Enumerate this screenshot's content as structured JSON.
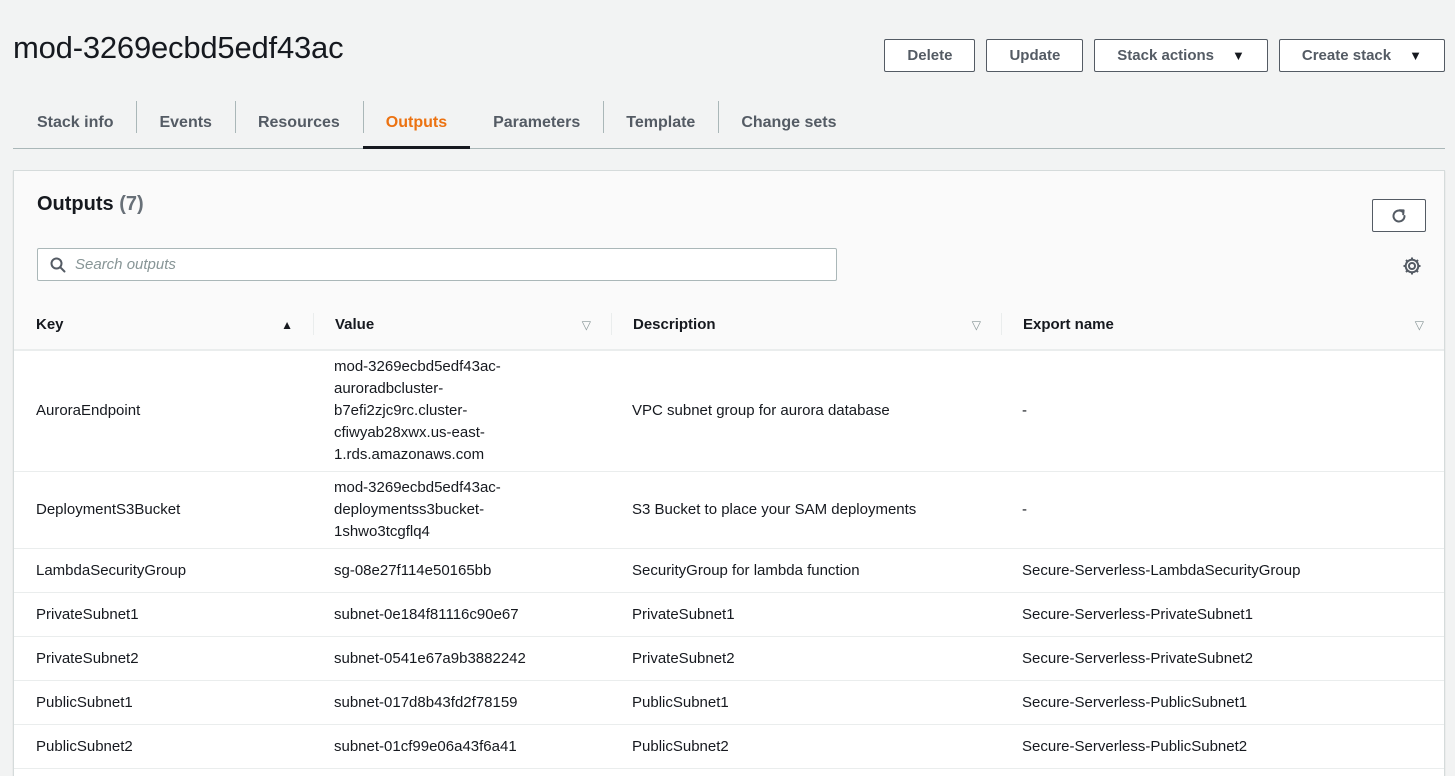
{
  "stack": {
    "name": "mod-3269ecbd5edf43ac"
  },
  "actions": {
    "delete": "Delete",
    "update": "Update",
    "stack_actions": "Stack actions",
    "create_stack": "Create stack"
  },
  "tabs": [
    {
      "label": "Stack info"
    },
    {
      "label": "Events"
    },
    {
      "label": "Resources"
    },
    {
      "label": "Outputs",
      "active": true
    },
    {
      "label": "Parameters"
    },
    {
      "label": "Template"
    },
    {
      "label": "Change sets"
    }
  ],
  "outputs": {
    "title": "Outputs",
    "count": "(7)",
    "search_placeholder": "Search outputs",
    "columns": [
      "Key",
      "Value",
      "Description",
      "Export name"
    ],
    "sort": {
      "column": "Key",
      "direction": "ascending"
    },
    "rows": [
      {
        "key": "AuroraEndpoint",
        "value_lines": [
          "mod-3269ecbd5edf43ac-",
          "auroradbcluster-",
          "b7efi2zjc9rc.cluster-",
          "cfiwyab28xwx.us-east-",
          "1.rds.amazonaws.com"
        ],
        "description": "VPC subnet group for aurora database",
        "export": "-"
      },
      {
        "key": "DeploymentS3Bucket",
        "value_lines": [
          "mod-3269ecbd5edf43ac-",
          "deploymentss3bucket-",
          "1shwo3tcgflq4"
        ],
        "description": "S3 Bucket to place your SAM deployments",
        "export": "-"
      },
      {
        "key": "LambdaSecurityGroup",
        "value_lines": [
          "sg-08e27f114e50165bb"
        ],
        "description": "SecurityGroup for lambda function",
        "export": "Secure-Serverless-LambdaSecurityGroup"
      },
      {
        "key": "PrivateSubnet1",
        "value_lines": [
          "subnet-0e184f81116c90e67"
        ],
        "description": "PrivateSubnet1",
        "export": "Secure-Serverless-PrivateSubnet1"
      },
      {
        "key": "PrivateSubnet2",
        "value_lines": [
          "subnet-0541e67a9b3882242"
        ],
        "description": "PrivateSubnet2",
        "export": "Secure-Serverless-PrivateSubnet2"
      },
      {
        "key": "PublicSubnet1",
        "value_lines": [
          "subnet-017d8b43fd2f78159"
        ],
        "description": "PublicSubnet1",
        "export": "Secure-Serverless-PublicSubnet1"
      },
      {
        "key": "PublicSubnet2",
        "value_lines": [
          "subnet-01cf99e06a43f6a41"
        ],
        "description": "PublicSubnet2",
        "export": "Secure-Serverless-PublicSubnet2"
      }
    ]
  },
  "colors": {
    "accent": "#ec7211",
    "text": "#16191f",
    "muted": "#545b64",
    "border": "#aab7b8"
  }
}
